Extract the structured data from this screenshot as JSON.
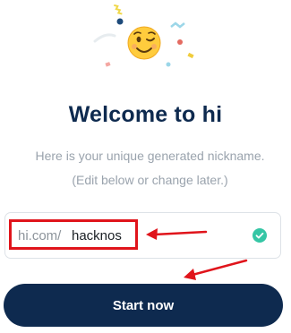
{
  "celebration": {
    "emoji": "😉",
    "icon": "winking-face-with-confetti"
  },
  "welcome": {
    "title": "Welcome to hi",
    "subtitle_line1": "Here is your unique generated nickname.",
    "subtitle_line2": "(Edit below or change later.)"
  },
  "nickname": {
    "prefix": "hi.com/",
    "value": "hacknos",
    "status_icon": "check-circle-icon"
  },
  "start_button": {
    "label": "Start now"
  },
  "colors": {
    "primary": "#0e2a4f",
    "success": "#35c6a5",
    "annotation": "#e0141b",
    "muted_text": "#9aa3ad"
  }
}
